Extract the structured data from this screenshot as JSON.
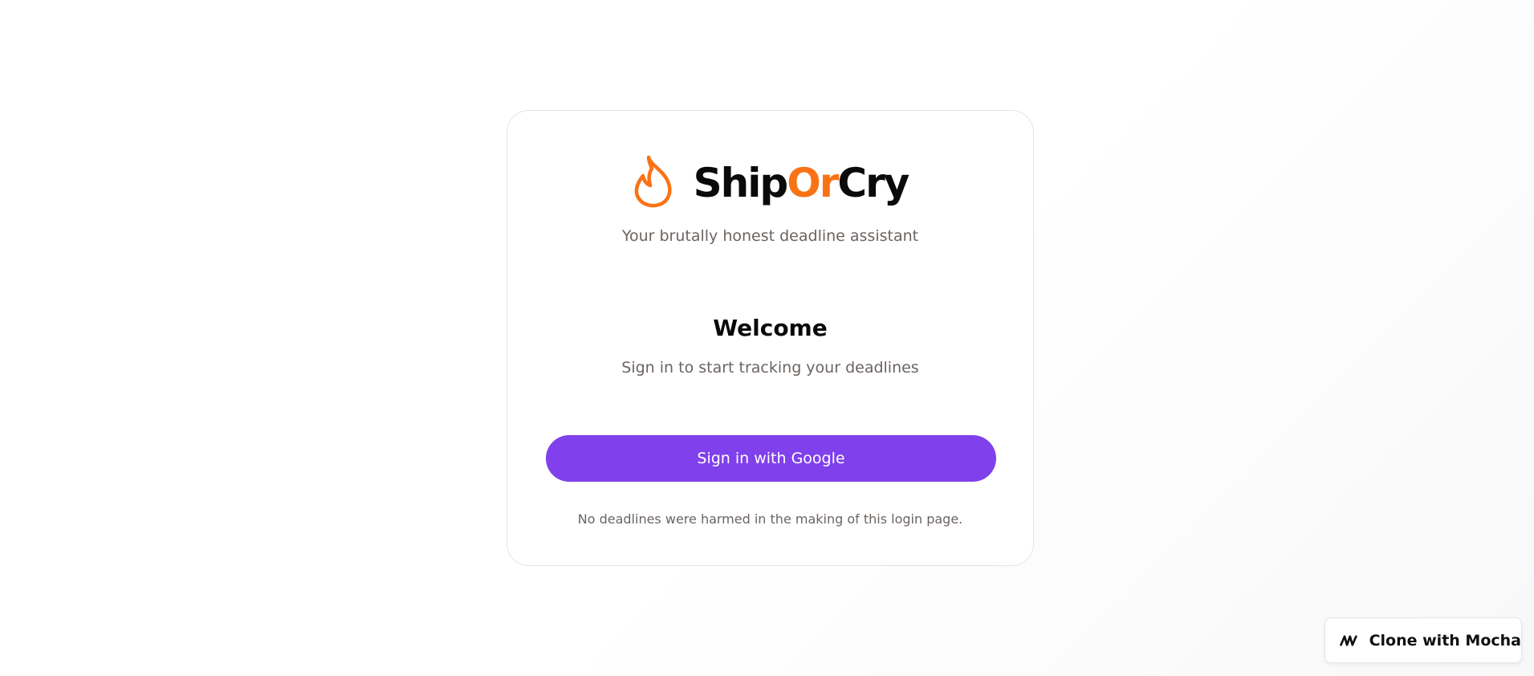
{
  "brand": {
    "name_part1": "Ship",
    "name_accent": "Or",
    "name_part2": "Cry",
    "logo_icon": "flame-icon",
    "accent_color": "#f97316"
  },
  "login": {
    "tagline": "Your brutally honest deadline assistant",
    "heading": "Welcome",
    "subheading": "Sign in to start tracking your deadlines",
    "google_button_label": "Sign in with Google",
    "button_color": "#8040ec",
    "footnote": "No deadlines were harmed in the making of this login page."
  },
  "mocha": {
    "label": "Clone with Mocha",
    "icon": "mocha-logo-icon"
  }
}
